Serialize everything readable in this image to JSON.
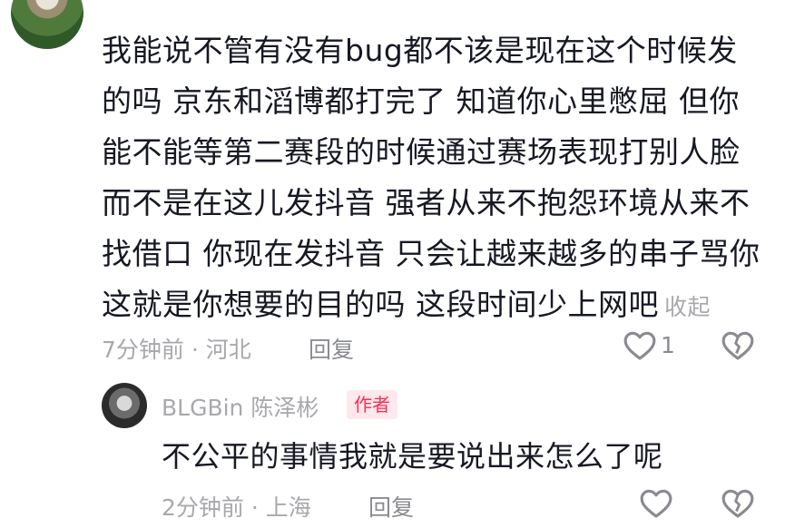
{
  "comment": {
    "lines": [
      "我能说不管有没有bug都不该是现在这个时候发",
      "的吗 京东和滔博都打完了 知道你心里憋屈 但你",
      "能不能等第二赛段的时候通过赛场表现打别人脸",
      "而不是在这儿发抖音 强者从来不抱怨环境从来不",
      "找借口 你现在发抖音 只会让越来越多的串子骂你",
      "这就是你想要的目的吗 这段时间少上网吧"
    ],
    "collapse_label": "收起",
    "time_location": "7分钟前 · 河北",
    "reply_label": "回复",
    "like_count": "1",
    "like_icon": "heart-outline-icon",
    "dislike_icon": "broken-heart-icon"
  },
  "reply": {
    "username": "BLGBin 陈泽彬",
    "badge": "作者",
    "text": "不公平的事情我就是要说出来怎么了呢",
    "time_location": "2分钟前 · 上海",
    "reply_label": "回复",
    "like_icon": "heart-outline-icon",
    "dislike_icon": "broken-heart-icon"
  },
  "colors": {
    "text": "#161823",
    "meta": "#a8a8ad",
    "accent": "#fe2c55",
    "badge_bg": "#fde9ec"
  }
}
